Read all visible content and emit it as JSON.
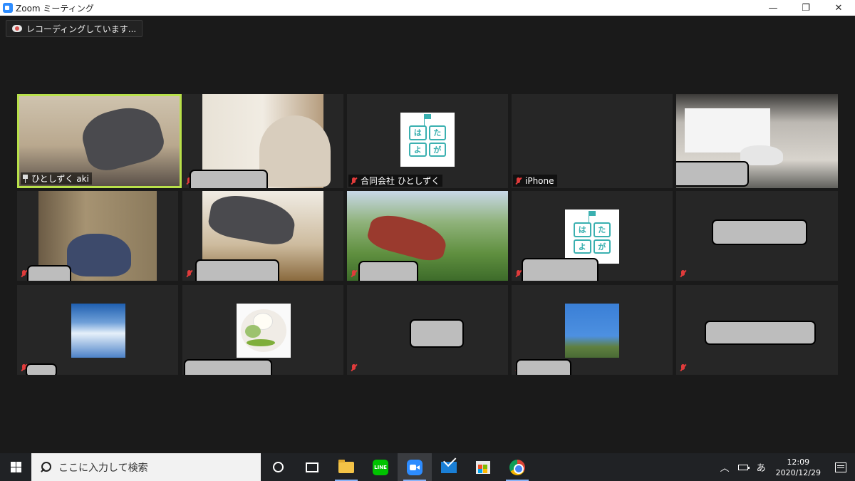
{
  "window": {
    "title": "Zoom ミーティング",
    "minimize_glyph": "—",
    "restore_glyph": "❐",
    "close_glyph": "✕"
  },
  "recording": {
    "label": "レコーディングしています..."
  },
  "participants": [
    {
      "name": "ひとしずく aki",
      "muted": false,
      "active_speaker": true,
      "content": "video",
      "name_hidden": false
    },
    {
      "name": "",
      "muted": true,
      "active_speaker": false,
      "content": "video",
      "name_hidden": true
    },
    {
      "name": "合同会社 ひとしずく",
      "muted": true,
      "active_speaker": false,
      "content": "logo",
      "name_hidden": false
    },
    {
      "name": "iPhone",
      "muted": true,
      "active_speaker": false,
      "content": "none",
      "name_hidden": false
    },
    {
      "name": "",
      "muted": false,
      "active_speaker": false,
      "content": "video",
      "name_hidden": true
    },
    {
      "name": "",
      "muted": true,
      "active_speaker": false,
      "content": "video",
      "name_hidden": true
    },
    {
      "name": "",
      "muted": true,
      "active_speaker": false,
      "content": "video",
      "name_hidden": true
    },
    {
      "name": "",
      "muted": true,
      "active_speaker": false,
      "content": "video",
      "name_hidden": true
    },
    {
      "name": "",
      "muted": true,
      "active_speaker": false,
      "content": "logo",
      "name_hidden": true
    },
    {
      "name": "",
      "muted": true,
      "active_speaker": false,
      "content": "none",
      "name_hidden": true
    },
    {
      "name": "",
      "muted": true,
      "active_speaker": false,
      "content": "sky-photo",
      "name_hidden": true
    },
    {
      "name": "",
      "muted": true,
      "active_speaker": false,
      "content": "food-photo",
      "name_hidden": true
    },
    {
      "name": "",
      "muted": true,
      "active_speaker": false,
      "content": "none",
      "name_hidden": true
    },
    {
      "name": "",
      "muted": true,
      "active_speaker": false,
      "content": "tree-photo",
      "name_hidden": true
    },
    {
      "name": "",
      "muted": true,
      "active_speaker": false,
      "content": "none",
      "name_hidden": true
    }
  ],
  "logo": {
    "cells": [
      "は",
      "た",
      "よ",
      "が"
    ]
  },
  "taskbar": {
    "search_placeholder": "ここに入力して検索",
    "apps": [
      "cortana",
      "task-view",
      "file-explorer",
      "line",
      "zoom",
      "mail",
      "microsoft-store",
      "chrome"
    ],
    "line_label": "LINE",
    "ime": "あ",
    "tray_chevron": "︿",
    "time": "12:09",
    "date": "2020/12/29"
  }
}
